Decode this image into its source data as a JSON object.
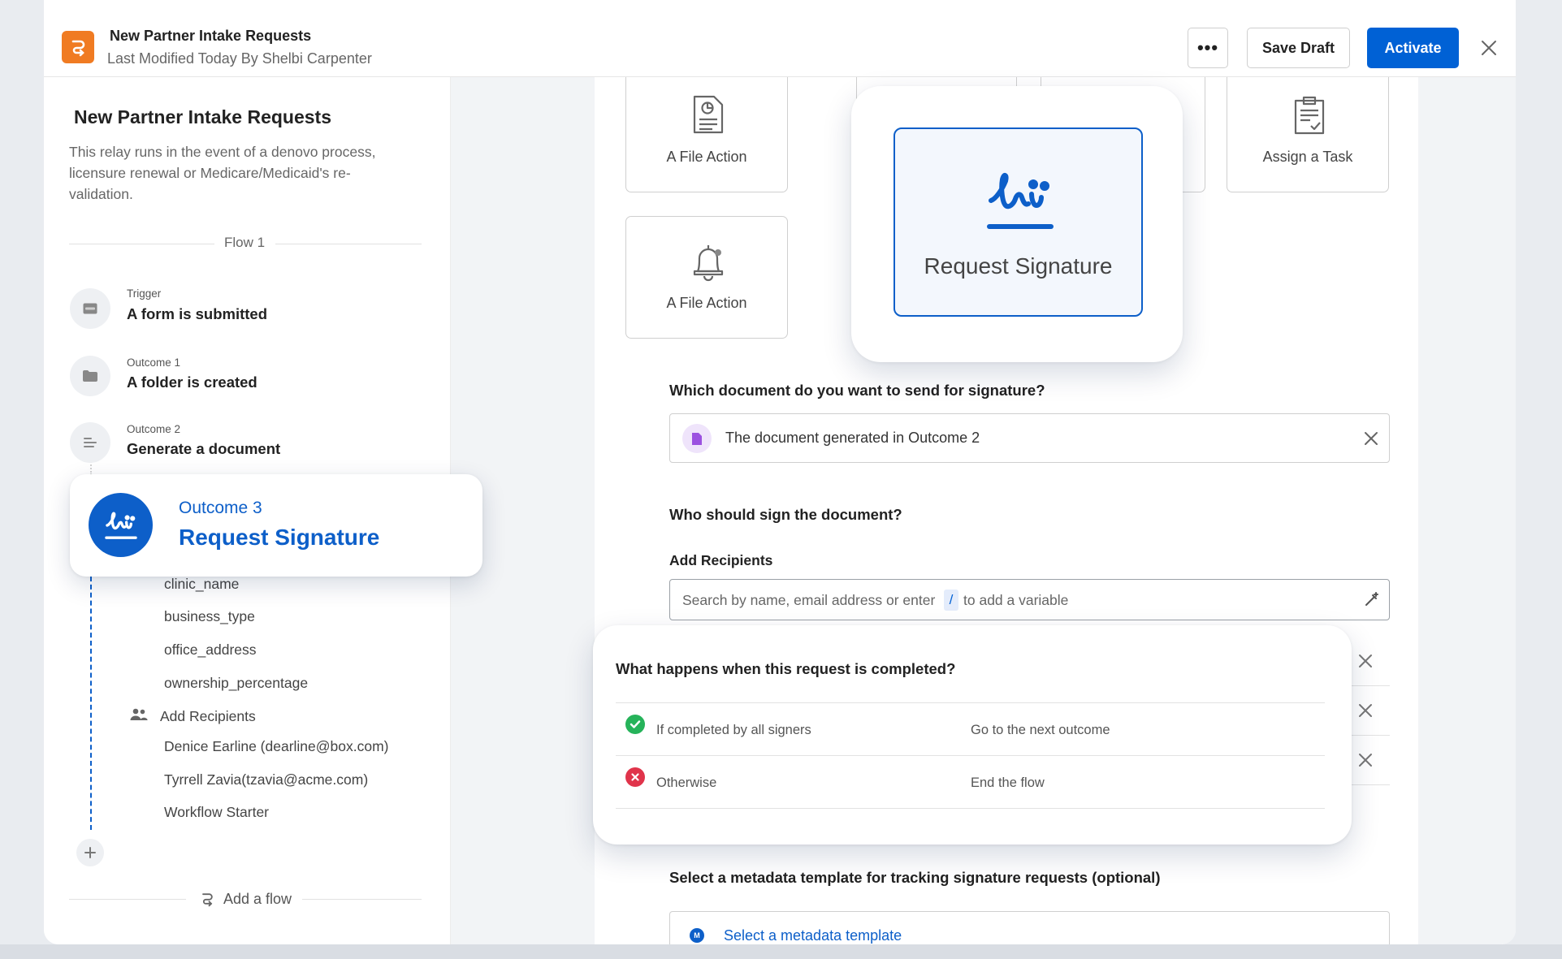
{
  "header": {
    "title": "New Partner Intake Requests",
    "subtitle": "Last Modified Today By Shelbi Carpenter",
    "more_label": "•••",
    "save_label": "Save Draft",
    "activate_label": "Activate"
  },
  "sidebar": {
    "title": "New Partner Intake Requests",
    "description": "This relay runs in the event of a denovo process, licensure renewal or Medicare/Medicaid's re-validation.",
    "flow_label": "Flow 1",
    "steps": [
      {
        "caption": "Trigger",
        "name": "A form is submitted",
        "icon": "form-icon"
      },
      {
        "caption": "Outcome 1",
        "name": "A folder is created",
        "icon": "folder-icon"
      },
      {
        "caption": "Outcome 2",
        "name": "Generate a document",
        "icon": "document-lines-icon"
      }
    ],
    "active_outcome": {
      "caption": "Outcome 3",
      "name": "Request Signature",
      "icon": "signature-icon"
    },
    "fields": [
      "clinic_name",
      "business_type",
      "office_address",
      "ownership_percentage"
    ],
    "recipients_label": "Add Recipients",
    "recipients": [
      "Denice Earline (dearline@box.com)",
      "Tyrrell Zavia(tzavia@acme.com)",
      "Workflow Starter"
    ],
    "add_flow_label": "Add a flow"
  },
  "actions": {
    "file_action_1": "A File Action",
    "file_action_2": "A File Action",
    "assign_task": "Assign a Task",
    "request_signature": "Request Signature"
  },
  "form": {
    "document_question": "Which document do you want to send for signature?",
    "document_value": "The document generated in Outcome 2",
    "signer_question": "Who should sign the document?",
    "add_recipients_label": "Add Recipients",
    "search_placeholder_a": "Search by name, email address or enter",
    "search_slash": "/",
    "search_placeholder_b": "to add a variable",
    "metadata_question": "Select a metadata template for tracking signature requests (optional)",
    "metadata_value": "Select a metadata template",
    "metadata_badge": "M"
  },
  "completion": {
    "title": "What happens when this request is completed?",
    "rows": [
      {
        "condition": "If completed by all signers",
        "result": "Go to the next outcome",
        "status_color": "#26b35a"
      },
      {
        "condition": "Otherwise",
        "result": "End the flow",
        "status_color": "#e0344b"
      }
    ]
  },
  "colors": {
    "brand_orange": "#f07b22",
    "primary_blue": "#0061d5",
    "signature_blue": "#0d5fc9",
    "document_purple": "#9b51e0"
  }
}
